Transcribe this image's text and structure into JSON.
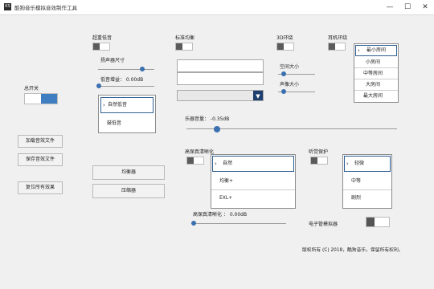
{
  "window": {
    "title": "酷狗音乐模拟音效制作工具",
    "icon_text": "KS",
    "controls": {
      "minimize": "—",
      "maximize": "☐",
      "close": "✕"
    }
  },
  "left": {
    "master_switch_label": "总开关",
    "master_on": true,
    "buttons": [
      "加载音效文件",
      "保存音效文件",
      "复位所有效果"
    ]
  },
  "mid_buttons": [
    "均衡器",
    "压缩器"
  ],
  "bass": {
    "title": "超重低音",
    "speaker_size_label": "扬声器尺寸",
    "gain_label": "低音增益： 0.00dB",
    "speaker_size_value": 0.9,
    "gain_value": 0.0,
    "options": [
      "自然低音",
      "鼓低音"
    ],
    "selected": 0
  },
  "standard": {
    "title": "标准均衡",
    "field1": "",
    "field2": "",
    "combo_value": ""
  },
  "surround3d": {
    "title": "3D环绕",
    "space_label": "空间大小",
    "sound_label": "声像大小",
    "space_value": 0.15,
    "sound_value": 0.15
  },
  "headphone": {
    "title": "耳机环绕",
    "options": [
      "最小房间",
      "小房间",
      "中等房间",
      "大房间",
      "最大房间"
    ],
    "selected": 0
  },
  "volume": {
    "label": "乐器音量： -0.35dB",
    "value": 0.08
  },
  "hifi": {
    "title": "高保真清晰化",
    "options": [
      "自然",
      "均衡+",
      "EXL+"
    ],
    "selected": 0,
    "slider_label": "高保真清晰化 ： 0.00dB",
    "slider_value": 0.0
  },
  "hearing": {
    "title": "听觉保护",
    "options": [
      "轻微",
      "中等",
      "剧烈"
    ],
    "selected": 0
  },
  "tube": {
    "label": "电子管模拟器",
    "on": false
  },
  "footer": "版权所有 (C) 2018，酷狗音乐，保留所有权利。"
}
